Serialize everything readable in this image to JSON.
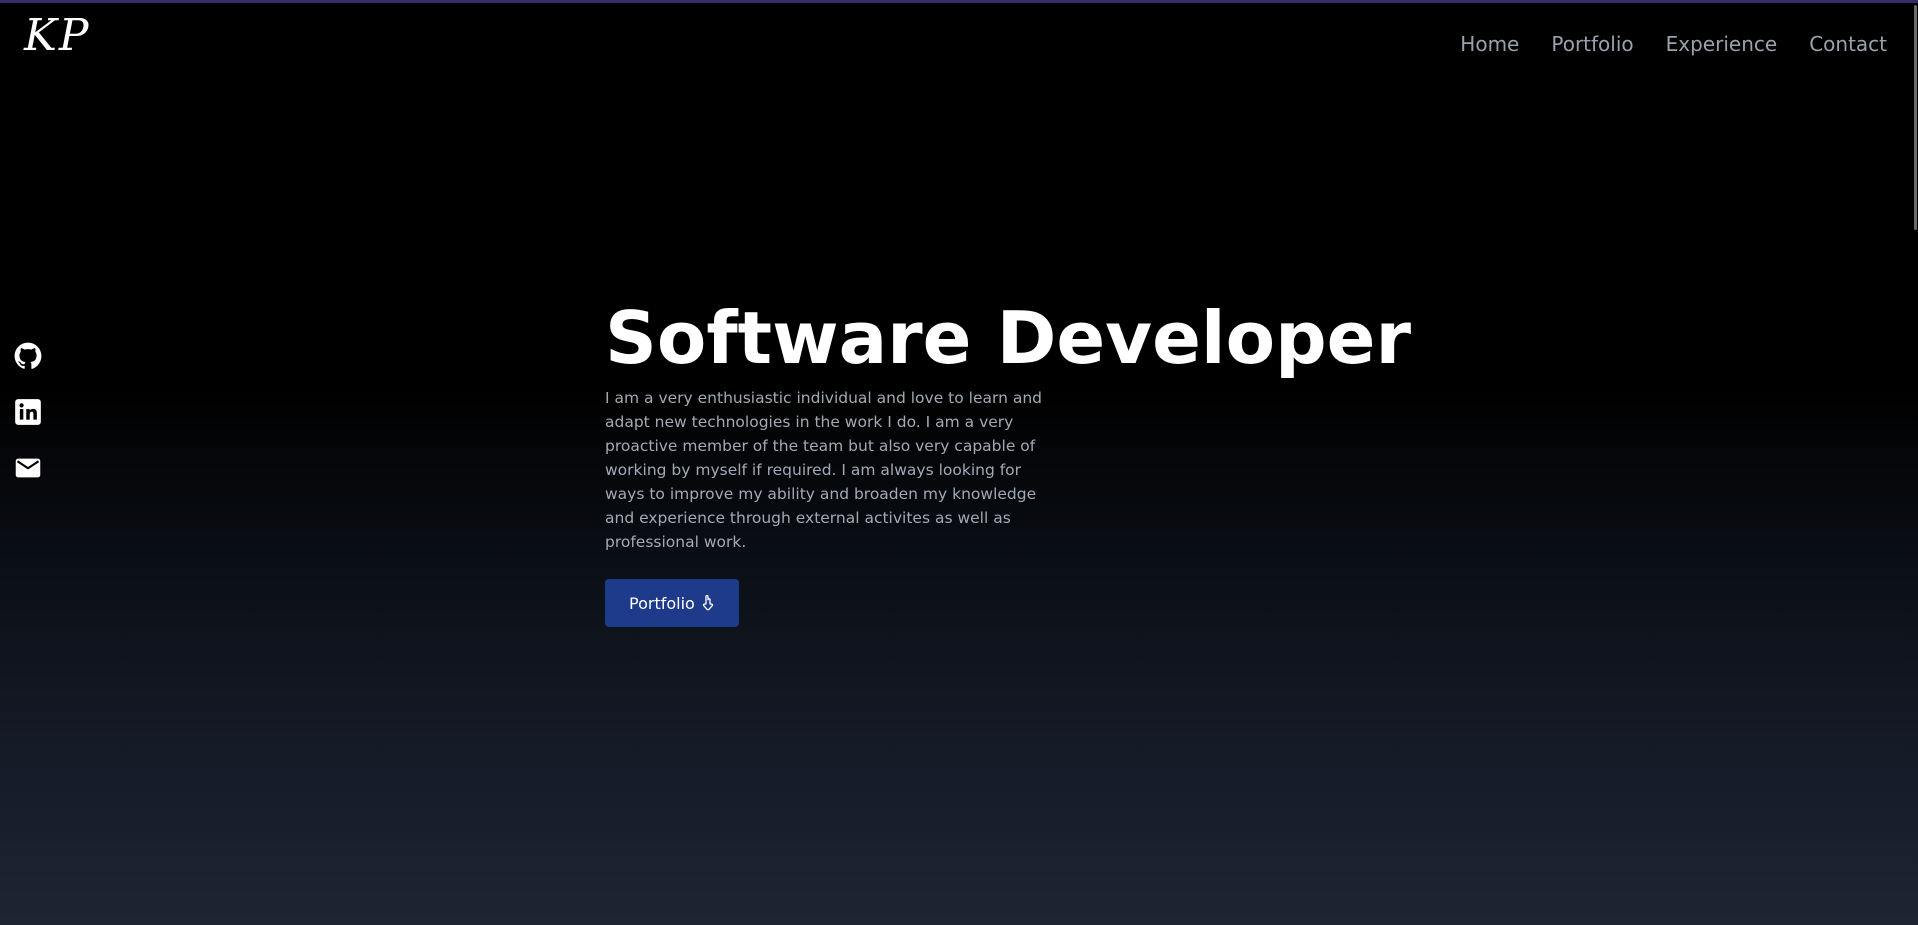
{
  "header": {
    "logo_text": "KP",
    "nav": [
      {
        "label": "Home"
      },
      {
        "label": "Portfolio"
      },
      {
        "label": "Experience"
      },
      {
        "label": "Contact"
      }
    ]
  },
  "social": [
    {
      "icon": "github-icon"
    },
    {
      "icon": "linkedin-icon"
    },
    {
      "icon": "mail-icon"
    }
  ],
  "hero": {
    "title": "Software Developer",
    "description": "I am a very enthusiastic individual and love to learn and adapt new technologies in the work I do. I am a very proactive member of the team but also very capable of working by myself if required. I am always looking for ways to improve my ability and broaden my knowledge and experience through external activites as well as professional work.",
    "button_label": "Portfolio",
    "button_icon": "pointing-hand-down-icon"
  },
  "colors": {
    "background_top": "#000000",
    "background_bottom": "#1d2533",
    "nav_text": "#9aa1ad",
    "body_text": "#a3a9b4",
    "button_bg": "#1e3a8a",
    "top_accent": "#3a2a6b"
  }
}
